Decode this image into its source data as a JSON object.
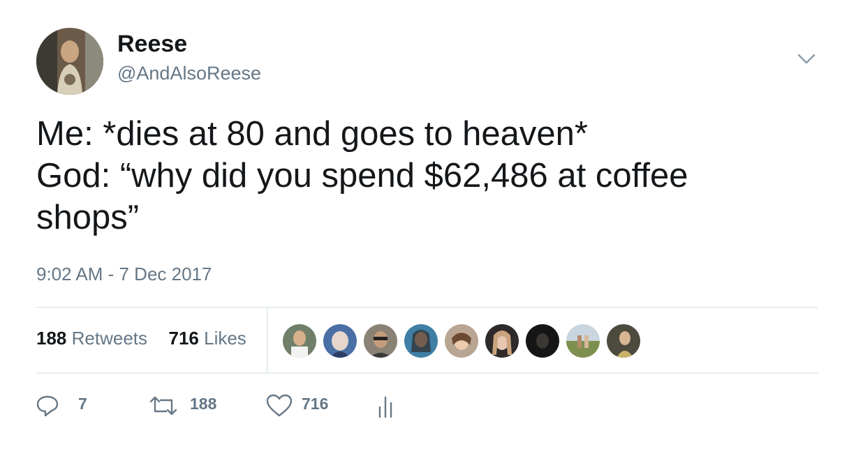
{
  "tweet": {
    "author_name": "Reese",
    "author_handle": "@AndAlsoReese",
    "text_lines": [
      "Me: *dies at 80 and goes to heaven*",
      "God: “why did you spend $62,486 at coffee",
      "shops”"
    ],
    "timestamp": "9:02 AM - 7 Dec 2017"
  },
  "stats": {
    "retweets_count": "188",
    "retweets_label": "Retweets",
    "likes_count": "716",
    "likes_label": "Likes",
    "liker_avatar_count": 9
  },
  "actions": {
    "reply_count": "7",
    "retweet_count": "188",
    "like_count": "716"
  },
  "colors": {
    "text": "#14171a",
    "secondary": "#657786",
    "divider": "#e6ecf0",
    "background": "#ffffff"
  },
  "icons": [
    "chevron-down-icon",
    "reply-icon",
    "retweet-icon",
    "heart-icon",
    "analytics-icon"
  ]
}
